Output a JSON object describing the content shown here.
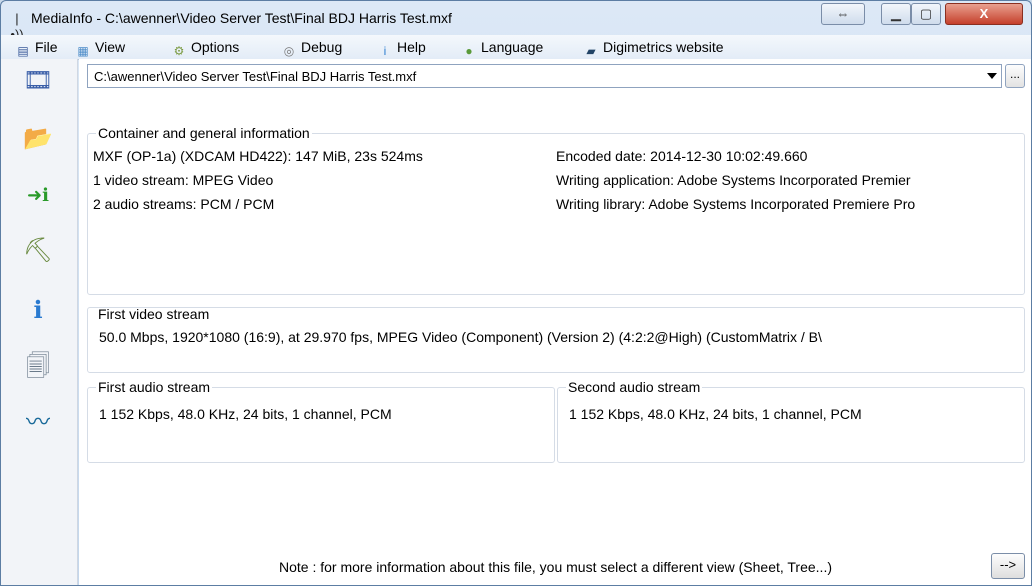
{
  "window": {
    "title": "MediaInfo - C:\\awenner\\Video Server Test\\Final BDJ Harris Test.mxf",
    "app_icon_glyph": "|•))",
    "controls": {
      "extra": "⇔",
      "minimize": "▁",
      "maximize": "▢",
      "close": "X"
    },
    "close_color": "#c5402c"
  },
  "menu": [
    {
      "label": "File",
      "icon": "file-icon",
      "icon_glyph": "▤",
      "icon_color": "#3a5a9a"
    },
    {
      "label": "View",
      "icon": "view-icon",
      "icon_glyph": "▦",
      "icon_color": "#4b8bc8"
    },
    {
      "label": "Options",
      "icon": "options-icon",
      "icon_glyph": "⚙",
      "icon_color": "#7a9a40"
    },
    {
      "label": "Debug",
      "icon": "debug-icon",
      "icon_glyph": "◎",
      "icon_color": "#777777"
    },
    {
      "label": "Help",
      "icon": "help-icon",
      "icon_glyph": "i",
      "icon_color": "#2f7fd0"
    },
    {
      "label": "Language",
      "icon": "language-icon",
      "icon_glyph": "●",
      "icon_color": "#5a9a3a"
    },
    {
      "label": "Digimetrics website",
      "icon": "digimetrics-icon",
      "icon_glyph": "▰",
      "icon_color": "#224466"
    }
  ],
  "sidebar": [
    {
      "name": "open-file-icon",
      "glyph": "🎞",
      "color": "#3a5ea8"
    },
    {
      "name": "open-folder-icon",
      "glyph": "📂",
      "color": "#d08a20"
    },
    {
      "name": "export-info-icon",
      "glyph": "➜ℹ",
      "color": "#2a9a2a"
    },
    {
      "name": "preferences-icon",
      "glyph": "⛏",
      "color": "#6a8a40"
    },
    {
      "name": "about-icon",
      "glyph": "ℹ",
      "color": "#2a7ad0"
    },
    {
      "name": "documents-web-icon",
      "glyph": "🗐",
      "color": "#6a7a8a"
    },
    {
      "name": "waveform-icon",
      "glyph": "〰",
      "color": "#1a6a9a"
    }
  ],
  "file_path": "C:\\awenner\\Video Server Test\\Final BDJ Harris Test.mxf",
  "browse_label": "...",
  "general": {
    "title": "Container and general information",
    "left": [
      "MXF (OP-1a) (XDCAM HD422): 147 MiB, 23s 524ms",
      "1 video stream: MPEG Video",
      "2 audio streams: PCM / PCM"
    ],
    "right": [
      "Encoded date: 2014-12-30 10:02:49.660",
      "Writing application: Adobe Systems Incorporated Premier",
      "Writing library: Adobe Systems Incorporated Premiere Pro"
    ]
  },
  "video": {
    "title": "First video stream",
    "text": "50.0 Mbps, 1920*1080 (16:9), at 29.970 fps, MPEG Video (Component) (Version 2) (4:2:2@High) (CustomMatrix / B\\"
  },
  "audio1": {
    "title": "First audio stream",
    "text": "1 152 Kbps, 48.0 KHz, 24 bits, 1 channel, PCM"
  },
  "audio2": {
    "title": "Second audio stream",
    "text": "1 152 Kbps, 48.0 KHz, 24 bits, 1 channel, PCM"
  },
  "note": "Note : for more information about this file, you must select a different view (Sheet, Tree...)",
  "next_label": "-->"
}
